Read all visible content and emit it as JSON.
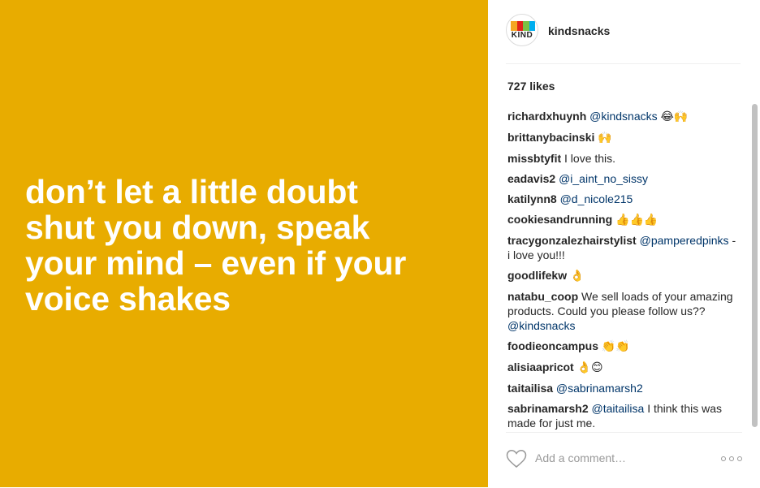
{
  "post": {
    "background_color": "#e8ac00",
    "quote_lines": [
      "don’t let a little doubt",
      "shut you down, speak",
      "your mind – even if your",
      "voice shakes"
    ]
  },
  "header": {
    "avatar_logo_text": "KIND",
    "logo_colors": [
      "#f5a623",
      "#e2231a",
      "#7ac143",
      "#00aeef"
    ],
    "username": "kindsnacks"
  },
  "likes": "727 likes",
  "comments": [
    {
      "user": "richardxhuynh",
      "mention": "@kindsnacks",
      "text": "",
      "emoji": "😂🙌"
    },
    {
      "user": "brittanybacinski",
      "mention": "",
      "text": "",
      "emoji": "🙌"
    },
    {
      "user": "missbtyfit",
      "mention": "",
      "text": "I love this.",
      "emoji": ""
    },
    {
      "user": "eadavis2",
      "mention": "@i_aint_no_sissy",
      "text": "",
      "emoji": ""
    },
    {
      "user": "katilynn8",
      "mention": "@d_nicole215",
      "text": "",
      "emoji": ""
    },
    {
      "user": "cookiesandrunning",
      "mention": "",
      "text": "",
      "emoji": "👍👍👍"
    },
    {
      "user": "tracygonzalezhairstylist",
      "mention": "@pamperedpinks",
      "text": "- i love you!!!",
      "emoji": ""
    },
    {
      "user": "goodlifekw",
      "mention": "",
      "text": "",
      "emoji": "👌"
    },
    {
      "user": "natabu_coop",
      "mention": "",
      "text": "We sell loads of your amazing products. Could you please follow us??",
      "mention2": "@kindsnacks",
      "emoji": ""
    },
    {
      "user": "foodieoncampus",
      "mention": "",
      "text": "",
      "emoji": "👏👏"
    },
    {
      "user": "alisiaapricot",
      "mention": "",
      "text": "",
      "emoji": "👌😊"
    },
    {
      "user": "taitailisa",
      "mention": "@sabrinamarsh2",
      "text": "",
      "emoji": ""
    },
    {
      "user": "sabrinamarsh2",
      "mention": "@taitailisa",
      "text": "I think this was made for just me.",
      "emoji": ""
    }
  ],
  "footer": {
    "add_comment_placeholder": "Add a comment…",
    "heart_icon": "heart-outline-icon",
    "more_icon": "more-options-icon"
  }
}
